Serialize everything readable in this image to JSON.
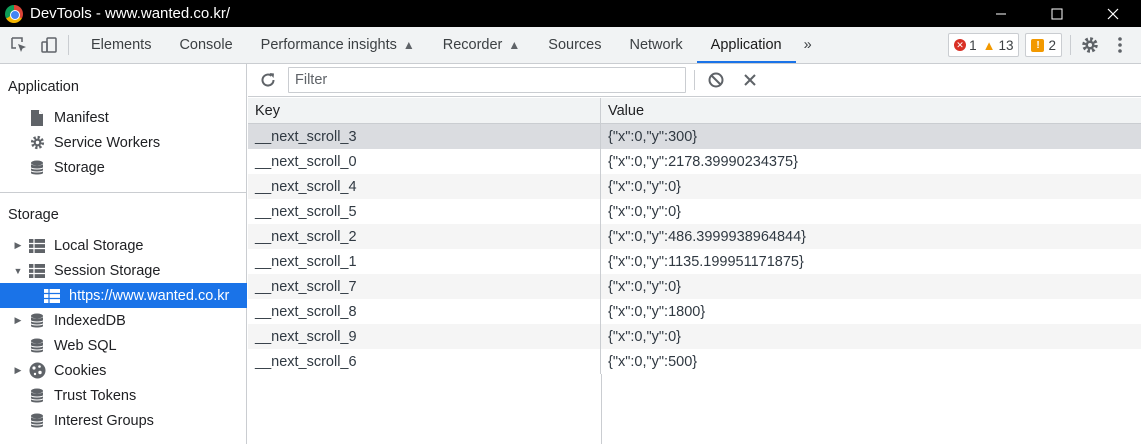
{
  "window": {
    "title": "DevTools - www.wanted.co.kr/"
  },
  "toolbar": {
    "tabs": [
      "Elements",
      "Console",
      "Performance insights",
      "Recorder",
      "Sources",
      "Network",
      "Application"
    ],
    "more_label": "»",
    "errors": "1",
    "warnings": "13",
    "issues": "2"
  },
  "sidebar": {
    "application_title": "Application",
    "application_items": [
      "Manifest",
      "Service Workers",
      "Storage"
    ],
    "storage_title": "Storage",
    "storage_items": [
      "Local Storage",
      "Session Storage",
      "https://www.wanted.co.kr",
      "IndexedDB",
      "Web SQL",
      "Cookies",
      "Trust Tokens",
      "Interest Groups"
    ]
  },
  "filter": {
    "placeholder": "Filter"
  },
  "table": {
    "headers": {
      "key": "Key",
      "value": "Value"
    },
    "rows": [
      {
        "key": "__next_scroll_3",
        "value": "{\"x\":0,\"y\":300}"
      },
      {
        "key": "__next_scroll_0",
        "value": "{\"x\":0,\"y\":2178.39990234375}"
      },
      {
        "key": "__next_scroll_4",
        "value": "{\"x\":0,\"y\":0}"
      },
      {
        "key": "__next_scroll_5",
        "value": "{\"x\":0,\"y\":0}"
      },
      {
        "key": "__next_scroll_2",
        "value": "{\"x\":0,\"y\":486.3999938964844}"
      },
      {
        "key": "__next_scroll_1",
        "value": "{\"x\":0,\"y\":1135.199951171875}"
      },
      {
        "key": "__next_scroll_7",
        "value": "{\"x\":0,\"y\":0}"
      },
      {
        "key": "__next_scroll_8",
        "value": "{\"x\":0,\"y\":1800}"
      },
      {
        "key": "__next_scroll_9",
        "value": "{\"x\":0,\"y\":0}"
      },
      {
        "key": "__next_scroll_6",
        "value": "{\"x\":0,\"y\":500}"
      }
    ]
  }
}
